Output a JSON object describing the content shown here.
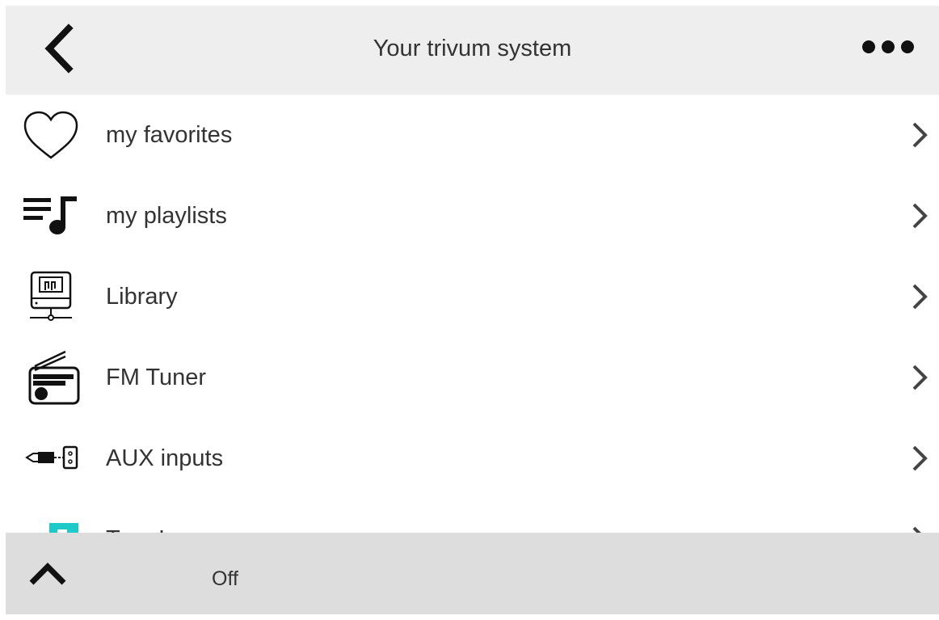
{
  "header": {
    "title": "Your trivum system",
    "back_icon": "chevron-left-icon",
    "more_icon": "more-horizontal-icon"
  },
  "menu": {
    "items": [
      {
        "label": "my favorites",
        "icon": "heart-icon"
      },
      {
        "label": "my playlists",
        "icon": "playlist-icon"
      },
      {
        "label": "Library",
        "icon": "library-drive-icon"
      },
      {
        "label": "FM Tuner",
        "icon": "radio-icon"
      },
      {
        "label": "AUX inputs",
        "icon": "aux-input-icon"
      },
      {
        "label": "TuneIn",
        "icon": "tunein-icon"
      }
    ]
  },
  "footer": {
    "status": "Off",
    "expand_icon": "chevron-up-icon"
  },
  "colors": {
    "header_bg": "#eeeeee",
    "footer_bg": "#dddddd",
    "tunein_accent": "#1dcac8"
  }
}
